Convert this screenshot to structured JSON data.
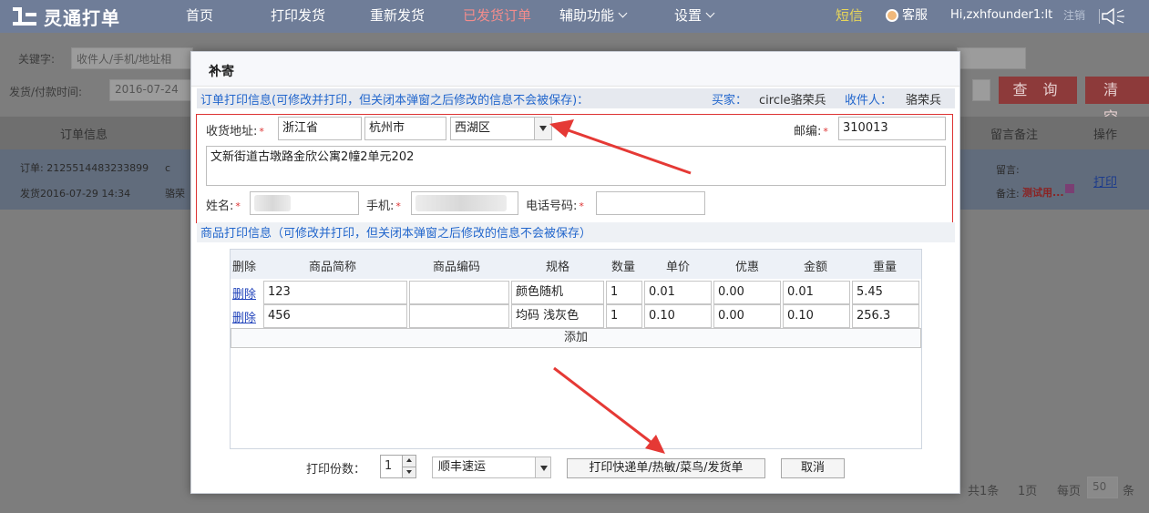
{
  "app": {
    "logo_text": "灵通打单"
  },
  "nav": {
    "items": [
      "首页",
      "打印发货",
      "重新发货",
      "已发货订单",
      "辅助功能",
      "设置"
    ],
    "sms": "短信",
    "service": "客服",
    "greeting": "Hi,zxhfounder1:lt",
    "logout": "注销"
  },
  "filters": {
    "keyword_label": "关键字:",
    "keyword_placeholder": "收件人/手机/地址相",
    "date_label": "发货/付款时间:",
    "date_value": "2016-07-24",
    "query_label": "查 询",
    "clear_label": "清 空"
  },
  "table_bg": {
    "headers": {
      "order_info": "订单信息",
      "remark": "留言备注",
      "action": "操作"
    },
    "row": {
      "order_no": "订单: 2125514483233899",
      "ship_time": "发货2016-07-29 14:34",
      "name_frag": "骆荣",
      "c_frag": "c",
      "msg_label": "留言:",
      "note_label": "备注:",
      "note_value": "测试用...",
      "print": "打印"
    },
    "footer": {
      "total": "共1条",
      "pages": "1页",
      "per_page_label": "每页",
      "per_page": "50",
      "unit": "条"
    }
  },
  "modal": {
    "title": "补寄",
    "order_section": "订单打印信息(可修改并打印，但关闭本弹窗之后修改的信息不会被保存)：",
    "buyer_label": "买家：",
    "buyer": "circle骆荣兵",
    "receiver_label": "收件人：",
    "receiver": "骆荣兵",
    "address": {
      "label": "收货地址:",
      "province": "浙江省",
      "city": "杭州市",
      "district": "西湖区",
      "zip_label": "邮编:",
      "zip": "310013",
      "detail": "文新街道古墩路金欣公寓2幢2单元202"
    },
    "name_label": "姓名:",
    "mobile_label": "手机:",
    "phone_label": "电话号码:",
    "goods_section": "商品打印信息（可修改并打印，但关闭本弹窗之后修改的信息不会被保存）",
    "goods_headers": [
      "删除",
      "商品简称",
      "商品编码",
      "规格",
      "数量",
      "单价",
      "优惠",
      "金额",
      "重量"
    ],
    "goods_rows": [
      {
        "del": "删除",
        "name": "123",
        "code": "",
        "spec": "颜色随机",
        "qty": "1",
        "price": "0.01",
        "discount": "0.00",
        "amount": "0.01",
        "weight": "5.45"
      },
      {
        "del": "删除",
        "name": "456",
        "code": "",
        "spec": "均码 浅灰色",
        "qty": "1",
        "price": "0.10",
        "discount": "0.00",
        "amount": "0.10",
        "weight": "256.3"
      }
    ],
    "add_label": "添加",
    "copies_label": "打印份数：",
    "copies": "1",
    "courier": "顺丰速运",
    "print_label": "打印快递单/热敏/菜鸟/发货单",
    "cancel_label": "取消"
  },
  "colors": {
    "accent_blue": "#2266cc",
    "required_red": "#d33333",
    "annotation_arrow": "#e53935"
  }
}
